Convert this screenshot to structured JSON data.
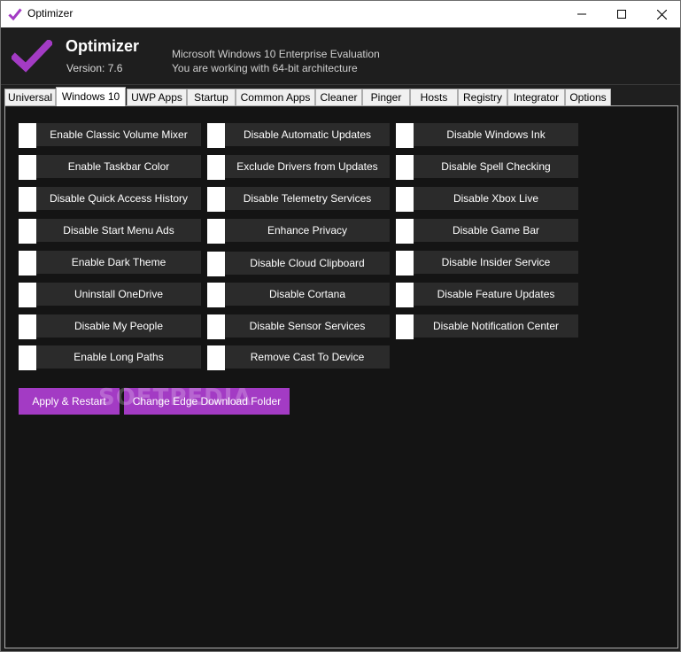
{
  "window": {
    "title": "Optimizer",
    "accent": "#a33bc4"
  },
  "header": {
    "app_name": "Optimizer",
    "version": "Version: 7.6",
    "os_info": "Microsoft Windows 10 Enterprise Evaluation",
    "arch_info": "You are working with 64-bit architecture"
  },
  "tabs": [
    {
      "label": "Universal"
    },
    {
      "label": "Windows 10"
    },
    {
      "label": "UWP Apps"
    },
    {
      "label": "Startup"
    },
    {
      "label": "Common Apps"
    },
    {
      "label": "Cleaner"
    },
    {
      "label": "Pinger"
    },
    {
      "label": "Hosts"
    },
    {
      "label": "Registry"
    },
    {
      "label": "Integrator"
    },
    {
      "label": "Options"
    }
  ],
  "active_tab": "Windows 10",
  "options": {
    "col1": [
      {
        "label": "Enable Classic Volume Mixer"
      },
      {
        "label": "Enable Taskbar Color"
      },
      {
        "label": "Disable Quick Access History"
      },
      {
        "label": "Disable Start Menu Ads"
      },
      {
        "label": "Enable Dark Theme"
      },
      {
        "label": "Uninstall OneDrive"
      },
      {
        "label": "Disable My People"
      },
      {
        "label": "Enable Long Paths"
      }
    ],
    "col2": [
      {
        "label": "Disable Automatic Updates"
      },
      {
        "label": "Exclude Drivers from Updates"
      },
      {
        "label": "Disable Telemetry Services"
      },
      {
        "label": "Enhance Privacy"
      },
      {
        "label": "Disable Cloud Clipboard"
      },
      {
        "label": "Disable Cortana"
      },
      {
        "label": "Disable Sensor Services"
      },
      {
        "label": "Remove Cast To Device"
      }
    ],
    "col3": [
      {
        "label": "Disable Windows Ink"
      },
      {
        "label": "Disable Spell Checking"
      },
      {
        "label": "Disable Xbox Live"
      },
      {
        "label": "Disable Game Bar"
      },
      {
        "label": "Disable Insider Service"
      },
      {
        "label": "Disable Feature Updates"
      },
      {
        "label": "Disable Notification Center"
      }
    ]
  },
  "actions": {
    "apply_restart": "Apply & Restart",
    "change_edge_folder": "Change Edge Download Folder"
  },
  "watermark": "SOFTPEDIA"
}
